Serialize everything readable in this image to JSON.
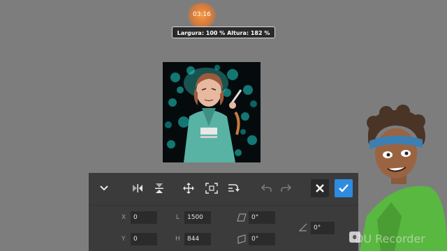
{
  "recorder": {
    "time": "03:16"
  },
  "status": {
    "dimensions_text": "Largura: 100 % Altura: 182 %"
  },
  "toolbar": {
    "icons": {
      "collapse": "chevron-down-icon",
      "flip_h": "flip-horizontal-icon",
      "flip_v": "flip-vertical-icon",
      "move": "move-arrows-icon",
      "fit": "fit-frame-icon",
      "rotate": "rotate-icon",
      "undo": "undo-icon",
      "redo": "redo-icon",
      "cancel": "close-icon",
      "confirm": "check-icon"
    },
    "colors": {
      "panel": "#3b3b3b",
      "confirm": "#2f8be0"
    }
  },
  "transform": {
    "x_label": "X",
    "x_value": "0",
    "y_label": "Y",
    "y_value": "0",
    "l_label": "L",
    "l_value": "1500",
    "h_label": "H",
    "h_value": "844",
    "skew_h_value": "0°",
    "skew_v_value": "0°",
    "rotate_value": "0°"
  },
  "watermark": {
    "text": "DU Recorder"
  }
}
